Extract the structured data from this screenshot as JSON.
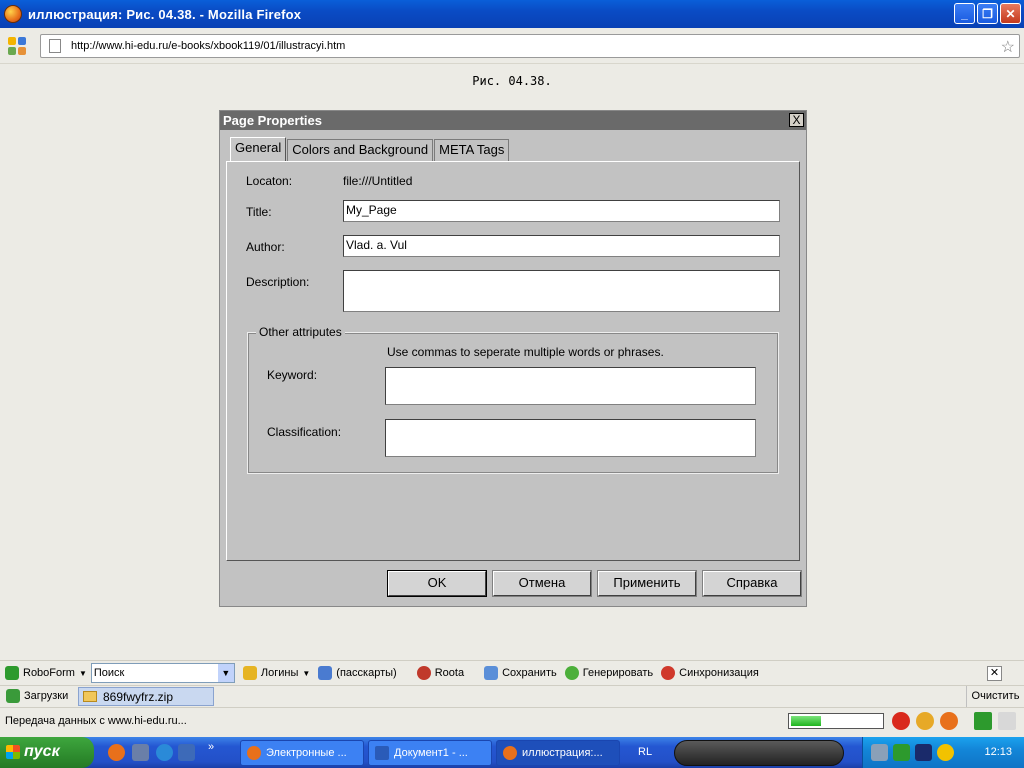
{
  "browser": {
    "window_title": "иллюстрация: Рис. 04.38. - Mozilla Firefox",
    "url": "http://www.hi-edu.ru/e-books/xbook119/01/illustracyi.htm"
  },
  "page": {
    "caption": "Рис. 04.38."
  },
  "dialog": {
    "title": "Page Properties",
    "close": "X",
    "tabs": [
      {
        "label": "General",
        "active": true
      },
      {
        "label": "Colors and Background",
        "active": false
      },
      {
        "label": "META Tags",
        "active": false
      }
    ],
    "location_label": "Locaton:",
    "location_value": "file:///Untitled",
    "title_label": "Title:",
    "title_value": "My_Page",
    "author_label": "Author:",
    "author_value": "Vlad. a. Vul",
    "description_label": "Description:",
    "description_value": "",
    "group_legend": "Other attriputes",
    "hint": "Use commas to seperate multiple words or phrases.",
    "keyword_label": "Keyword:",
    "keyword_value": "",
    "classification_label": "Classification:",
    "classification_value": "",
    "buttons": {
      "ok": "OK",
      "cancel": "Отмена",
      "apply": "Применить",
      "help": "Справка"
    }
  },
  "roboform": {
    "name": "RoboForm",
    "search_placeholder": "Поиск",
    "logins": "Логины",
    "passcards": "(пасскарты)",
    "roota": "Roota",
    "save": "Сохранить",
    "generate": "Генерировать",
    "sync": "Синхронизация"
  },
  "downloads": {
    "label": "Загрузки",
    "file": "869fwyfrz.zip",
    "clear": "Очистить"
  },
  "status": {
    "text": "Передача данных с www.hi-edu.ru...",
    "progress": 0.33
  },
  "taskbar": {
    "start": "пуск",
    "tasks": [
      {
        "label": "Электронные ...",
        "active": false
      },
      {
        "label": "Документ1 - ...",
        "active": false
      },
      {
        "label": "иллюстрация:...",
        "active": true
      }
    ],
    "lang": "RL",
    "time": "12:13"
  },
  "colors": {
    "title_bar": "#0a4bc4",
    "dialog_title": "#6a6a6a",
    "dialog_bg": "#c2c2c2",
    "taskbar": "#2457d2"
  }
}
